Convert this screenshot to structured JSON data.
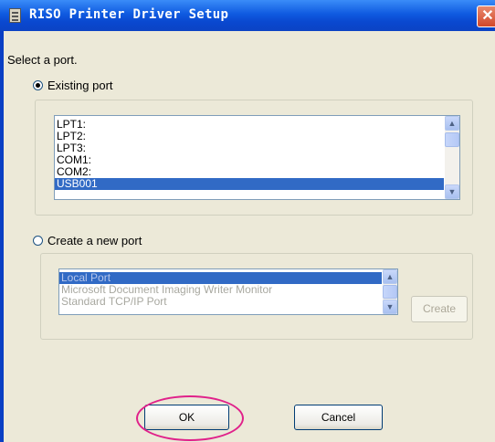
{
  "window": {
    "title": "RISO Printer Driver Setup",
    "close_symbol": "✕"
  },
  "prompt": "Select a port.",
  "existing_port": {
    "label": "Existing port",
    "checked": true,
    "ports": [
      "LPT1:",
      "LPT2:",
      "LPT3:",
      "COM1:",
      "COM2:",
      "USB001"
    ],
    "selected": "USB001"
  },
  "new_port": {
    "label": "Create a new port",
    "checked": false,
    "types": [
      "Local Port",
      "Microsoft Document Imaging Writer Monitor",
      "Standard TCP/IP Port"
    ],
    "selected": "Local Port",
    "create_label": "Create"
  },
  "buttons": {
    "ok": "OK",
    "cancel": "Cancel"
  },
  "colors": {
    "highlight_ring": "#E0218A",
    "selection": "#316AC5",
    "titlebar": "#0F5AE0"
  }
}
